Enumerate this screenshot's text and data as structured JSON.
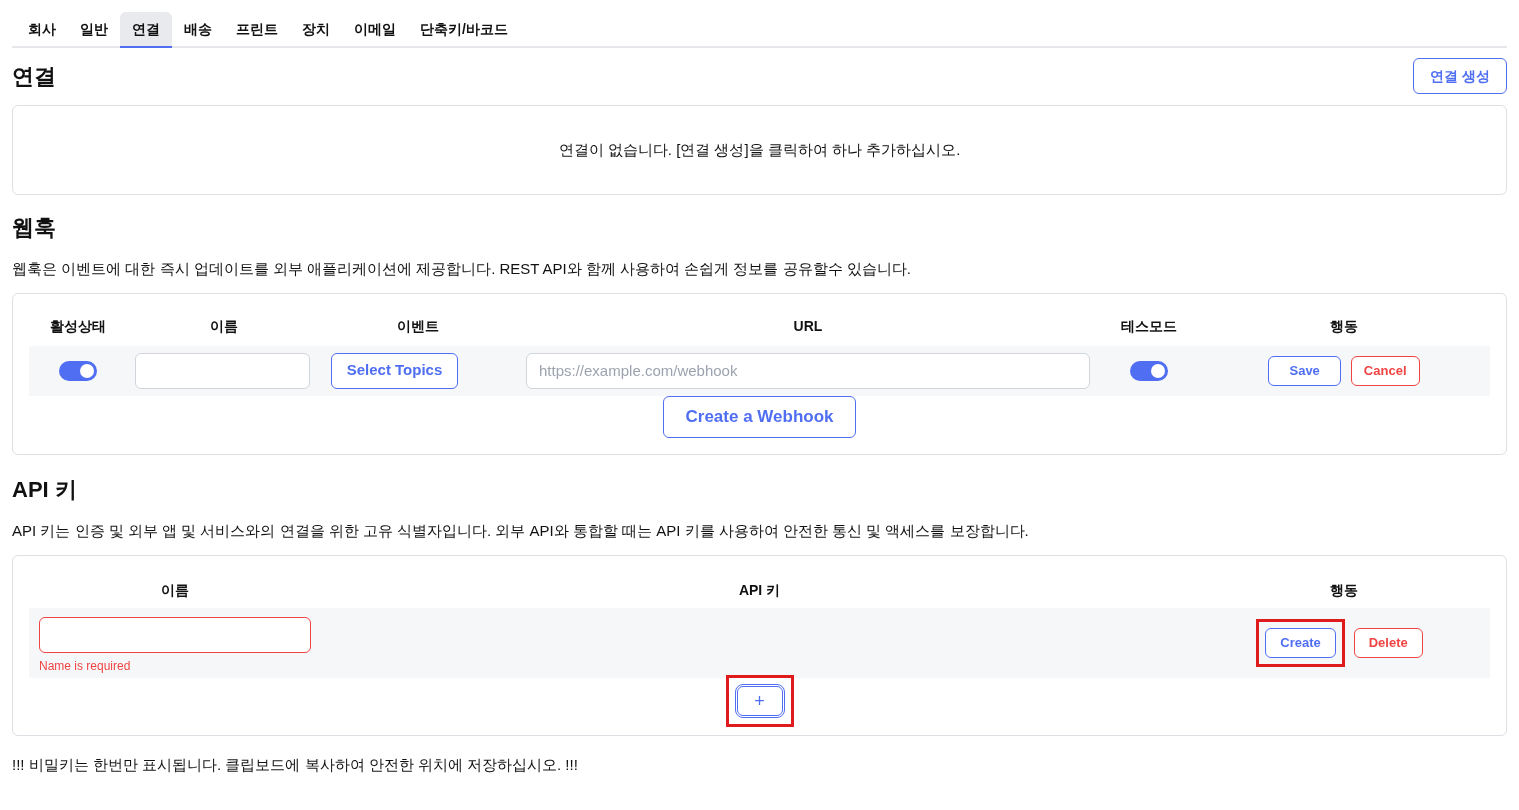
{
  "tabs": [
    {
      "label": "회사",
      "selected": false
    },
    {
      "label": "일반",
      "selected": false
    },
    {
      "label": "연결",
      "selected": true
    },
    {
      "label": "배송",
      "selected": false
    },
    {
      "label": "프린트",
      "selected": false
    },
    {
      "label": "장치",
      "selected": false
    },
    {
      "label": "이메일",
      "selected": false
    },
    {
      "label": "단축키/바코드",
      "selected": false
    }
  ],
  "connections": {
    "title": "연결",
    "create_button": "연결 생성",
    "empty_message": "연결이 없습니다. [연결 생성]을 클릭하여 하나 추가하십시오."
  },
  "webhooks": {
    "title": "웹훅",
    "description": "웹훅은 이벤트에 대한 즉시 업데이트를 외부 애플리케이션에 제공합니다. REST API와 함께 사용하여 손쉽게 정보를 공유할수 있습니다.",
    "columns": [
      "활성상태",
      "이름",
      "이벤트",
      "URL",
      "테스모드",
      "행동"
    ],
    "rows": [
      {
        "active": true,
        "name": "",
        "events_button": "Select Topics",
        "url_placeholder": "https://example.com/webhook",
        "test_mode": true,
        "save": "Save",
        "cancel": "Cancel"
      }
    ],
    "create_button": "Create a Webhook"
  },
  "api_keys": {
    "title": "API 키",
    "description": "API 키는 인증 및 외부 앱 및 서비스와의 연결을 위한 고유 식별자입니다. 외부 API와 통합할 때는 API 키를 사용하여 안전한 통신 및 액세스를 보장합니다.",
    "columns": [
      "이름",
      "API 키",
      "행동"
    ],
    "rows": [
      {
        "name": "",
        "error": "Name is required",
        "create": {
          "label": "Create",
          "highlighted": true
        },
        "delete": {
          "label": "Delete",
          "highlighted": false
        }
      }
    ],
    "add_button": {
      "label": "+",
      "highlighted": true
    }
  },
  "footer_note": "!!! 비밀키는 한번만 표시됩니다. 클립보드에 복사하여 안전한 위치에 저장하십시오. !!!"
}
